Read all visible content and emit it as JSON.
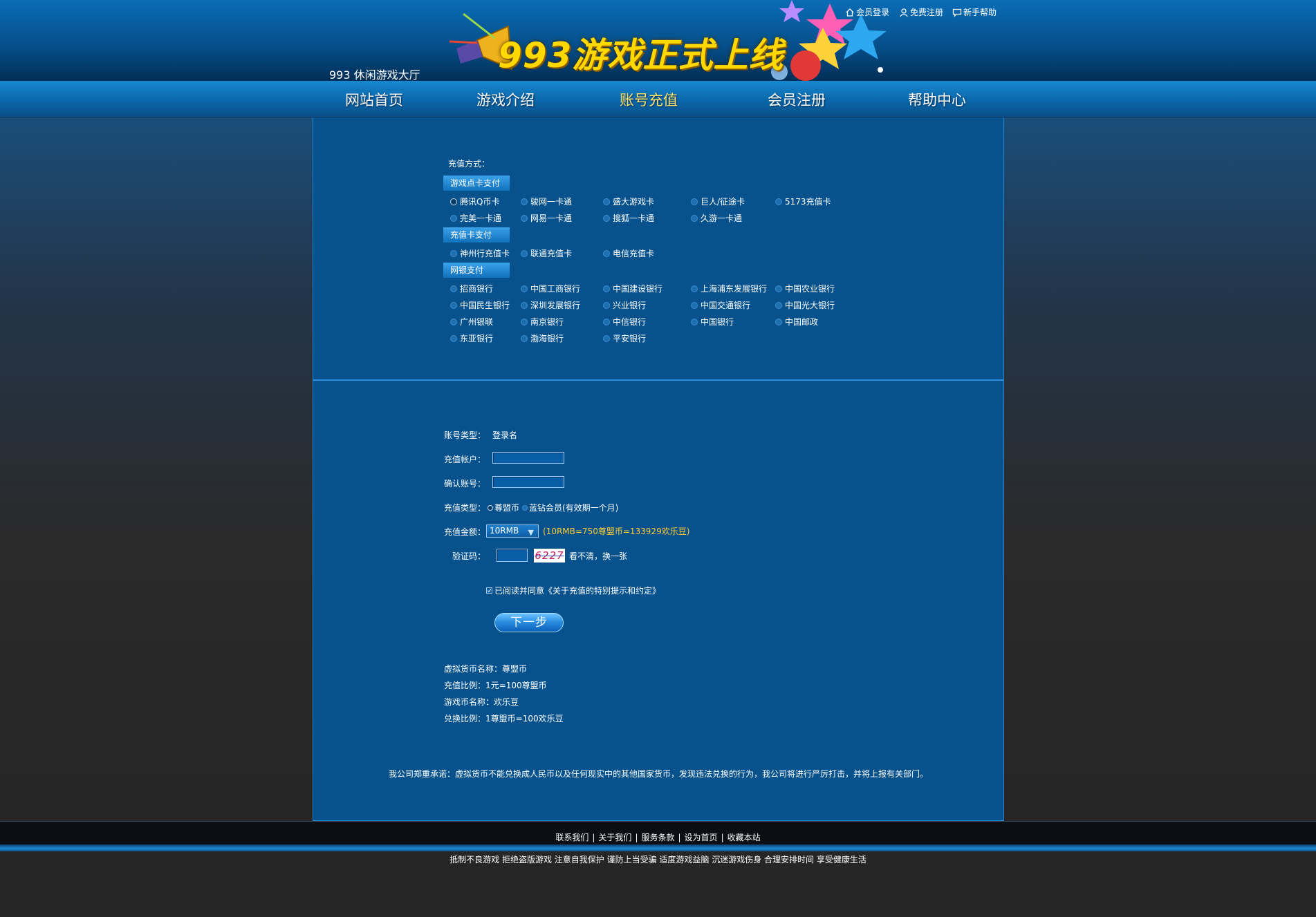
{
  "header": {
    "site_name": "993 休闲游戏大厅",
    "banner_title": "993游戏正式上线",
    "top_links": [
      {
        "label": "会员登录",
        "icon": "home-icon"
      },
      {
        "label": "免费注册",
        "icon": "user-icon"
      },
      {
        "label": "新手帮助",
        "icon": "chat-icon"
      }
    ]
  },
  "nav": {
    "items": [
      "网站首页",
      "游戏介绍",
      "账号充值",
      "会员注册",
      "帮助中心"
    ],
    "active": "账号充值"
  },
  "payment": {
    "method_label": "充值方式：",
    "sections": [
      {
        "title": "游戏点卡支付",
        "rows": [
          [
            "腾讯Q币卡",
            "骏网一卡通",
            "盛大游戏卡",
            "巨人/征途卡",
            "5173充值卡"
          ],
          [
            "完美一卡通",
            "网易一卡通",
            "搜狐一卡通",
            "久游一卡通"
          ]
        ]
      },
      {
        "title": "充值卡支付",
        "rows": [
          [
            "神州行充值卡",
            "联通充值卡",
            "电信充值卡"
          ]
        ]
      },
      {
        "title": "网银支付",
        "rows": [
          [
            "招商银行",
            "中国工商银行",
            "中国建设银行",
            "上海浦东发展银行",
            "中国农业银行"
          ],
          [
            "中国民生银行",
            "深圳发展银行",
            "兴业银行",
            "中国交通银行",
            "中国光大银行"
          ],
          [
            "广州银联",
            "南京银行",
            "中信银行",
            "中国银行",
            "中国邮政"
          ],
          [
            "东亚银行",
            "渤海银行",
            "平安银行"
          ]
        ]
      }
    ],
    "selected": "腾讯Q币卡"
  },
  "form": {
    "account_type_label": "账号类型：",
    "account_type_value": "登录名",
    "account_label": "充值帐户：",
    "confirm_label": "确认账号：",
    "account_value": "",
    "confirm_value": "",
    "type_label": "充值类型：",
    "type_options": [
      "尊盟币",
      "蓝钻会员(有效期一个月)"
    ],
    "type_selected": "尊盟币",
    "amount_label": "充值金额：",
    "amount_selected": "10RMB",
    "rate_note": "(10RMB=750尊盟币=133929欢乐豆)",
    "captcha_label": "验证码：",
    "captcha_value": "",
    "captcha_image_text": "6227",
    "refresh_text": "看不清，换一张",
    "agree_text": "已阅读并同意《关于充值的特别提示和约定》",
    "agree_checked": true,
    "next_label": "下一步"
  },
  "info": [
    "虚拟货币名称：尊盟币",
    "充值比例：1元=100尊盟币",
    "游戏币名称：欢乐豆",
    "兑换比例：1尊盟币=100欢乐豆"
  ],
  "notice": "我公司郑重承诺：虚拟货币不能兑换成人民币以及任何现实中的其他国家货币，发现违法兑换的行为，我公司将进行严厉打击，并将上报有关部门。",
  "footer": {
    "links": [
      "联系我们",
      "关于我们",
      "服务条款",
      "设为首页",
      "收藏本站"
    ],
    "separator": "|",
    "health_tip": "抵制不良游戏 拒绝盗版游戏 注意自我保护 谨防上当受骗 适度游戏益脑 沉迷游戏伤身 合理安排时间 享受健康生活"
  },
  "colors": {
    "accent": "#ffcc33",
    "panel": "#07528d",
    "nav_active": "#ffe46a"
  }
}
